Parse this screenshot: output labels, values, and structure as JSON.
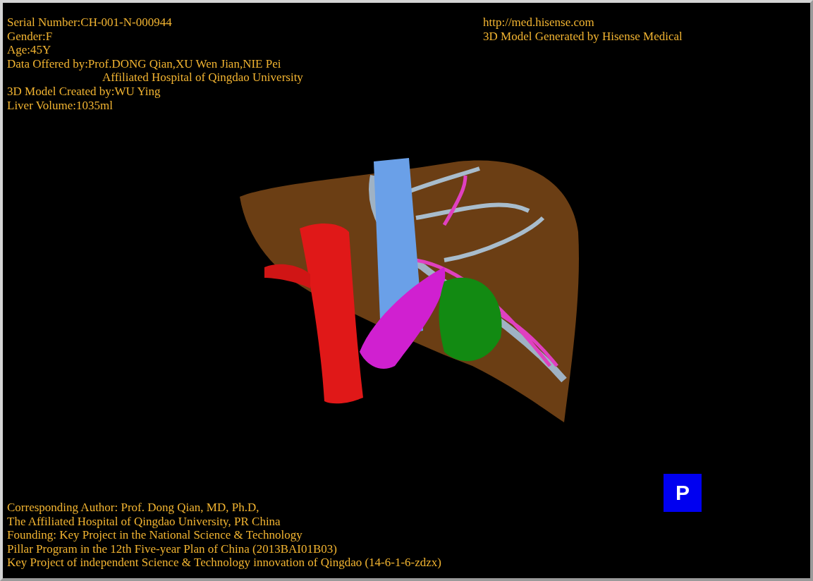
{
  "info_lines": [
    {
      "kind": "line",
      "text": "Serial Number:CH-001-N-000944"
    },
    {
      "kind": "line",
      "text": "Gender:F"
    },
    {
      "kind": "line",
      "text": "Age:45Y"
    },
    {
      "kind": "line",
      "text": "Data Offered by:Prof.DONG Qian,XU Wen Jian,NIE Pei"
    },
    {
      "kind": "continuation",
      "text": "Affiliated Hospital of Qingdao University"
    },
    {
      "kind": "line",
      "text": "3D Model Created by:WU Ying"
    },
    {
      "kind": "line",
      "text": "Liver Volume:1035ml"
    }
  ],
  "brand_lines": [
    "http://med.hisense.com",
    "3D Model Generated by Hisense Medical"
  ],
  "credit_lines": [
    "Corresponding Author: Prof. Dong Qian, MD, Ph.D,",
    "The Affiliated Hospital of Qingdao University, PR China",
    "Founding: Key Project in the National Science & Technology",
    "Pillar Program in the 12th Five-year Plan of China (2013BAI01B03)",
    "Key Project of independent Science & Technology innovation of Qingdao (14-6-1-6-zdzx)"
  ],
  "projection_button": {
    "label": "P"
  }
}
